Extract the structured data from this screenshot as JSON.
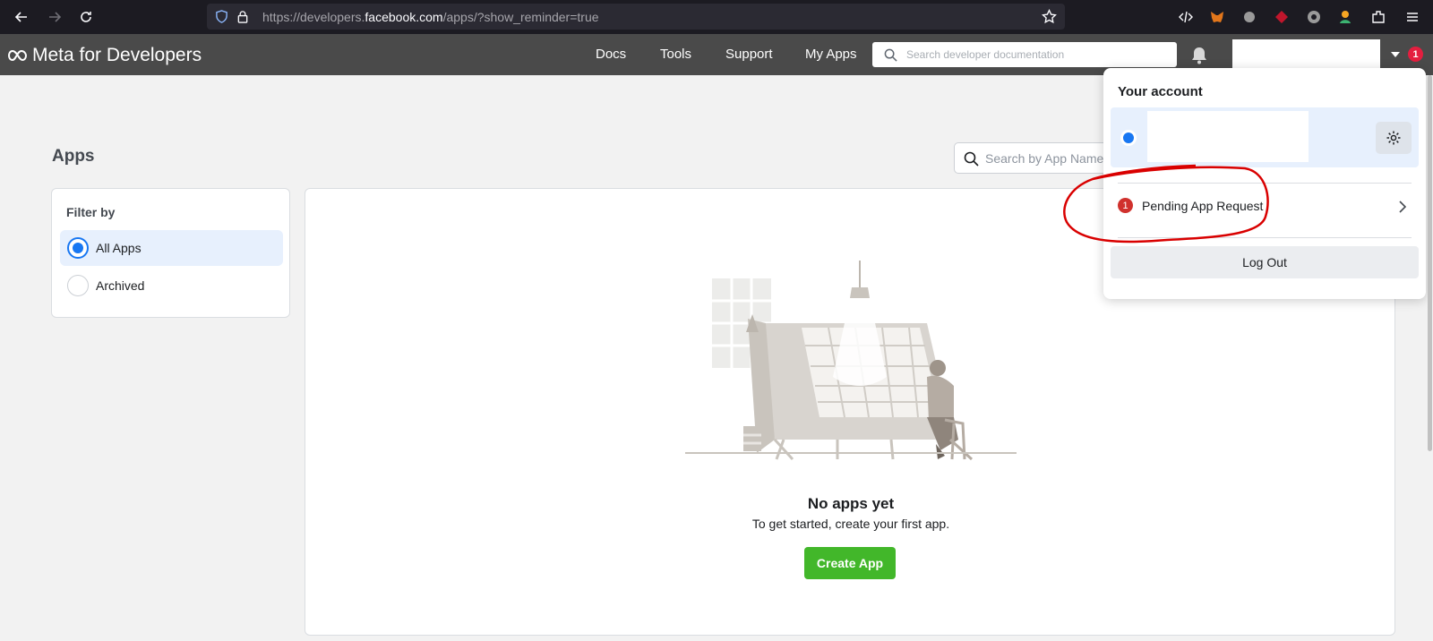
{
  "browser": {
    "url_prefix": "https://developers.",
    "url_domain": "facebook.com",
    "url_suffix": "/apps/?show_reminder=true"
  },
  "header": {
    "logo_text": "Meta for Developers",
    "nav": [
      "Docs",
      "Tools",
      "Support",
      "My Apps"
    ],
    "search_placeholder": "Search developer documentation",
    "notification_count": "1"
  },
  "page": {
    "title": "Apps",
    "search_placeholder": "Search by App Name"
  },
  "filter": {
    "title": "Filter by",
    "options": [
      {
        "label": "All Apps",
        "selected": true
      },
      {
        "label": "Archived",
        "selected": false
      }
    ]
  },
  "empty_state": {
    "title": "No apps yet",
    "subtitle": "To get started, create your first app.",
    "button": "Create App"
  },
  "account_menu": {
    "title": "Your account",
    "pending_count": "1",
    "pending_label": "Pending App Request",
    "logout_label": "Log Out"
  },
  "colors": {
    "accent": "#1877f2",
    "create_button": "#42b72a",
    "badge": "#e41e3f",
    "annotation": "#d90000"
  }
}
